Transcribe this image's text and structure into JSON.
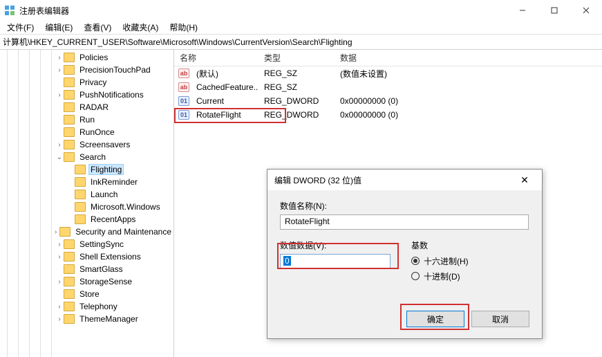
{
  "window": {
    "title": "注册表编辑器"
  },
  "menu": {
    "file": "文件(F)",
    "edit": "编辑(E)",
    "view": "查看(V)",
    "favorites": "收藏夹(A)",
    "help": "帮助(H)"
  },
  "address": "计算机\\HKEY_CURRENT_USER\\Software\\Microsoft\\Windows\\CurrentVersion\\Search\\Flighting",
  "tree": [
    {
      "indent": 5,
      "exp": ">",
      "label": "Policies"
    },
    {
      "indent": 5,
      "exp": ">",
      "label": "PrecisionTouchPad"
    },
    {
      "indent": 5,
      "exp": "",
      "label": "Privacy"
    },
    {
      "indent": 5,
      "exp": ">",
      "label": "PushNotifications"
    },
    {
      "indent": 5,
      "exp": "",
      "label": "RADAR"
    },
    {
      "indent": 5,
      "exp": "",
      "label": "Run"
    },
    {
      "indent": 5,
      "exp": "",
      "label": "RunOnce"
    },
    {
      "indent": 5,
      "exp": ">",
      "label": "Screensavers"
    },
    {
      "indent": 5,
      "exp": "v",
      "label": "Search"
    },
    {
      "indent": 6,
      "exp": "",
      "label": "Flighting",
      "selected": true
    },
    {
      "indent": 6,
      "exp": "",
      "label": "InkReminder"
    },
    {
      "indent": 6,
      "exp": "",
      "label": "Launch"
    },
    {
      "indent": 6,
      "exp": "",
      "label": "Microsoft.Windows"
    },
    {
      "indent": 6,
      "exp": "",
      "label": "RecentApps"
    },
    {
      "indent": 5,
      "exp": ">",
      "label": "Security and Maintenance"
    },
    {
      "indent": 5,
      "exp": ">",
      "label": "SettingSync"
    },
    {
      "indent": 5,
      "exp": ">",
      "label": "Shell Extensions"
    },
    {
      "indent": 5,
      "exp": "",
      "label": "SmartGlass"
    },
    {
      "indent": 5,
      "exp": ">",
      "label": "StorageSense"
    },
    {
      "indent": 5,
      "exp": "",
      "label": "Store"
    },
    {
      "indent": 5,
      "exp": ">",
      "label": "Telephony"
    },
    {
      "indent": 5,
      "exp": ">",
      "label": "ThemeManager"
    }
  ],
  "columns": {
    "name": "名称",
    "type": "类型",
    "data": "数据"
  },
  "values": [
    {
      "icon": "str",
      "name": "(默认)",
      "type": "REG_SZ",
      "data": "(数值未设置)"
    },
    {
      "icon": "str",
      "name": "CachedFeature...",
      "type": "REG_SZ",
      "data": ""
    },
    {
      "icon": "dw",
      "name": "Current",
      "type": "REG_DWORD",
      "data": "0x00000000 (0)"
    },
    {
      "icon": "dw",
      "name": "RotateFlight",
      "type": "REG_DWORD",
      "data": "0x00000000 (0)"
    }
  ],
  "dialog": {
    "title": "编辑 DWORD (32 位)值",
    "name_label": "数值名称(N):",
    "name_value": "RotateFlight",
    "data_label": "数值数据(V):",
    "data_value": "0",
    "base_label": "基数",
    "hex_label": "十六进制(H)",
    "dec_label": "十进制(D)",
    "ok": "确定",
    "cancel": "取消"
  }
}
